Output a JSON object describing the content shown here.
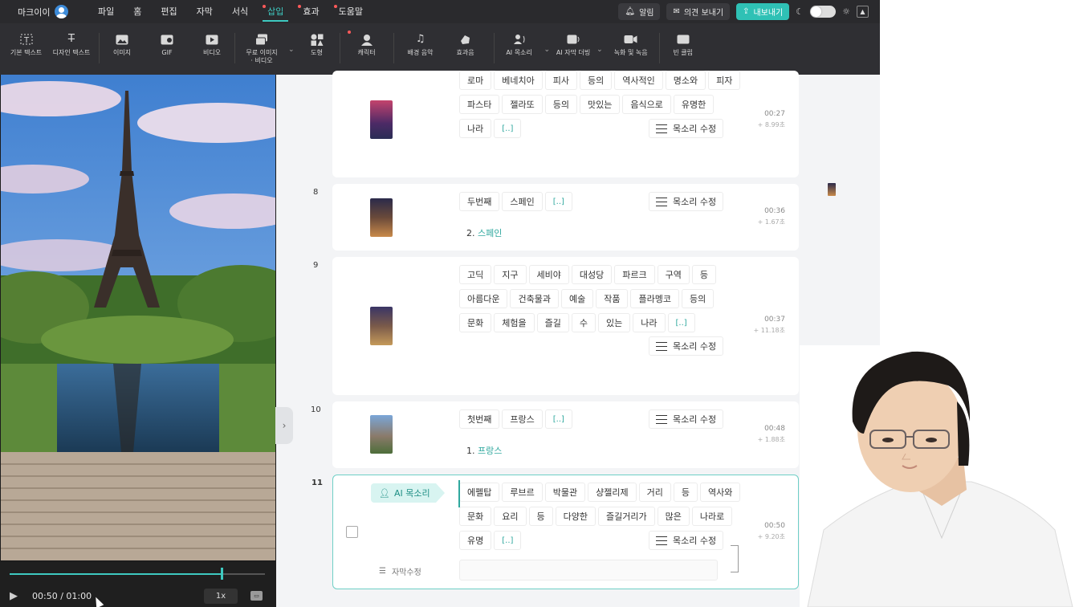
{
  "menubar": {
    "brand": "마크이이",
    "items": [
      {
        "label": "파일",
        "active": false,
        "dot": false
      },
      {
        "label": "홈",
        "active": false,
        "dot": false
      },
      {
        "label": "편집",
        "active": false,
        "dot": false
      },
      {
        "label": "자막",
        "active": false,
        "dot": false
      },
      {
        "label": "서식",
        "active": false,
        "dot": false
      },
      {
        "label": "삽입",
        "active": true,
        "dot": true
      },
      {
        "label": "효과",
        "active": false,
        "dot": true
      },
      {
        "label": "도움말",
        "active": false,
        "dot": true
      }
    ],
    "alert": "알림",
    "feedback": "의견 보내기",
    "export": "내보내기"
  },
  "toolbar": {
    "basic_text": "기본 텍스트",
    "design_text": "디자인 텍스트",
    "image": "이미지",
    "gif": "GIF",
    "video": "비디오",
    "free_media_1": "무료 이미지",
    "free_media_2": "· 비디오",
    "shape": "도형",
    "character": "캐릭터",
    "bgm": "배경 음악",
    "sfx": "효과음",
    "ai_voice": "AI 목소리",
    "ai_dub": "AI 자막 더빙",
    "record": "녹화 및 녹음",
    "blank_clip": "빈 클립"
  },
  "player": {
    "time": "00:50 / 01:00",
    "progress": 0.83,
    "speed": "1x"
  },
  "common": {
    "voice_edit": "목소리 수정",
    "bracket": "[..]",
    "ai_voice_badge": "AI 목소리",
    "caption_edit": "자막수정"
  },
  "scenes": [
    {
      "num": "",
      "words": [
        [
          "로마",
          "베네치아",
          "피사",
          "등의",
          "역사적인",
          "명소와",
          "피자"
        ],
        [
          "파스타",
          "젤라또",
          "등의",
          "맛있는",
          "음식으로",
          "유명한"
        ],
        [
          "나라",
          "[..]"
        ]
      ],
      "time": "00:27",
      "duration": "+ 8.99초"
    },
    {
      "num": "8",
      "words": [
        [
          "두번째",
          "스페인",
          "[..]"
        ]
      ],
      "numbered": "2.",
      "numbered_text": "스페인",
      "time": "00:36",
      "duration": "+ 1.67초"
    },
    {
      "num": "9",
      "words": [
        [
          "고딕",
          "지구",
          "세비야",
          "대성당",
          "파르크",
          "구역",
          "등"
        ],
        [
          "아름다운",
          "건축물과",
          "예술",
          "작품",
          "플라멩코",
          "등의"
        ],
        [
          "문화",
          "체험을",
          "즐길",
          "수",
          "있는",
          "나라",
          "[..]"
        ]
      ],
      "time": "00:37",
      "duration": "+ 11.18초"
    },
    {
      "num": "10",
      "words": [
        [
          "첫번째",
          "프랑스",
          "[..]"
        ]
      ],
      "numbered": "1.",
      "numbered_text": "프랑스",
      "time": "00:48",
      "duration": "+ 1.88초"
    },
    {
      "num": "11",
      "words": [
        [
          "에펠탑",
          "루브르",
          "박물관",
          "샹젤리제",
          "거리",
          "등",
          "역사와"
        ],
        [
          "문화",
          "요리",
          "등",
          "다양한",
          "즐길거리가",
          "많은",
          "나라로"
        ],
        [
          "유명",
          "[..]"
        ]
      ],
      "time": "00:50",
      "duration": "+ 9.20초"
    }
  ],
  "colors": {
    "accent": "#3ec9c0",
    "menubar": "#2a2a2d",
    "toolbar": "#2f2f33",
    "editor_bg": "#f3f4f6"
  }
}
